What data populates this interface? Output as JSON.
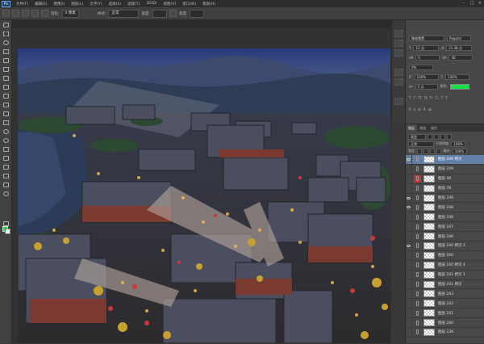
{
  "app": {
    "logo": "Ps"
  },
  "menubar": {
    "items": [
      "文件(F)",
      "编辑(E)",
      "图像(I)",
      "图层(L)",
      "文字(Y)",
      "选择(S)",
      "滤镜(T)",
      "3D(D)",
      "视图(V)",
      "窗口(W)",
      "帮助(H)"
    ],
    "window_controls": [
      "–",
      "□",
      "×"
    ]
  },
  "options_bar": {
    "feather_label": "羽化:",
    "feather_value": "0 像素",
    "style_label": "样式:",
    "style_value": "正常",
    "width_label": "宽度:",
    "height_label": "高度:"
  },
  "character_panel": {
    "font_family": "微软雅黑",
    "font_style": "Regular",
    "font_size": "12 点",
    "leading": "21.38 点",
    "kerning": "0",
    "tracking": "40",
    "scale_v": "0%",
    "scale_h_label": "100%",
    "scale_v_label": "100%",
    "baseline": "0 点",
    "color_label": "颜色:",
    "color": "#19e04a"
  },
  "layers_panel": {
    "tabs": [
      "图层",
      "通道",
      "路径"
    ],
    "kind_label": "类型",
    "blend_mode": "正常",
    "opacity_label": "不透明度:",
    "opacity": "100%",
    "lock_label": "锁定:",
    "fill_label": "填充:",
    "fill": "100%",
    "layers": [
      {
        "name": "图层 249 拷贝",
        "visible": true,
        "selected": true,
        "swatch": ""
      },
      {
        "name": "图层 249",
        "visible": false,
        "selected": false,
        "swatch": ""
      },
      {
        "name": "图层 48",
        "visible": false,
        "selected": false,
        "swatch": "#c83232"
      },
      {
        "name": "图层 78",
        "visible": false,
        "selected": false,
        "swatch": ""
      },
      {
        "name": "图层 249",
        "visible": true,
        "selected": false,
        "swatch": ""
      },
      {
        "name": "图层 248",
        "visible": true,
        "selected": false,
        "swatch": ""
      },
      {
        "name": "图层 248",
        "visible": false,
        "selected": false,
        "swatch": ""
      },
      {
        "name": "图层 247",
        "visible": false,
        "selected": false,
        "swatch": ""
      },
      {
        "name": "图层 246",
        "visible": false,
        "selected": false,
        "swatch": ""
      },
      {
        "name": "图层 160 拷贝 2",
        "visible": true,
        "selected": false,
        "swatch": ""
      },
      {
        "name": "图层 160",
        "visible": false,
        "selected": false,
        "swatch": ""
      },
      {
        "name": "图层 160 拷贝 4",
        "visible": false,
        "selected": false,
        "swatch": ""
      },
      {
        "name": "图层 241 拷贝 1",
        "visible": false,
        "selected": false,
        "swatch": ""
      },
      {
        "name": "图层 241 拷贝",
        "visible": false,
        "selected": false,
        "swatch": ""
      },
      {
        "name": "图层 243",
        "visible": false,
        "selected": false,
        "swatch": ""
      },
      {
        "name": "图层 242",
        "visible": false,
        "selected": false,
        "swatch": ""
      },
      {
        "name": "图层 241",
        "visible": false,
        "selected": false,
        "swatch": ""
      },
      {
        "name": "图层 240",
        "visible": false,
        "selected": false,
        "swatch": ""
      },
      {
        "name": "图层 239",
        "visible": false,
        "selected": false,
        "swatch": ""
      }
    ]
  },
  "colors": {
    "foreground": "#19e04a",
    "background": "#ffffff",
    "selection": "#6080a8"
  }
}
